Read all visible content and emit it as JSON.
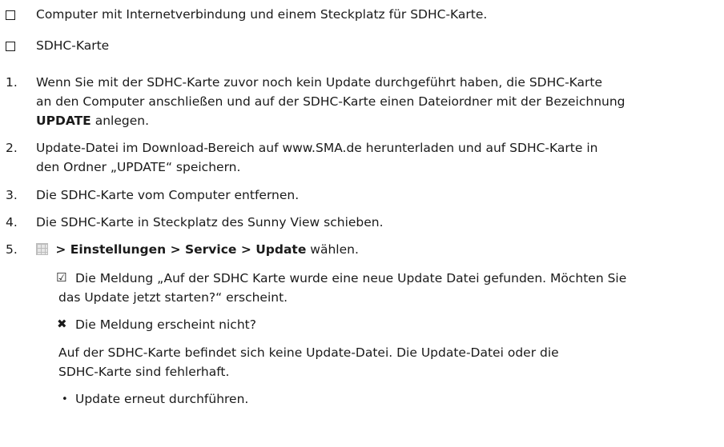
{
  "requirements": [
    "Computer mit Internetverbindung und einem Steckplatz für SDHC-Karte.",
    "SDHC-Karte"
  ],
  "steps": {
    "s1": {
      "num": "1.",
      "l1": "Wenn Sie mit der SDHC-Karte zuvor noch kein Update durchgeführt haben, die SDHC-Karte",
      "l2": "an den Computer anschließen und auf der SDHC-Karte einen Dateiordner mit der Bezeichnung",
      "l3_bold": "UPDATE",
      "l3_rest": " anlegen."
    },
    "s2": {
      "num": "2.",
      "l1": "Update-Datei im Download-Bereich auf www.SMA.de herunterladen und auf SDHC-Karte in",
      "l2": "den Ordner „UPDATE“ speichern."
    },
    "s3": {
      "num": "3.",
      "text": "Die SDHC-Karte vom Computer entfernen."
    },
    "s4": {
      "num": "4.",
      "text": "Die SDHC-Karte in Steckplatz des Sunny View schieben."
    },
    "s5": {
      "num": "5.",
      "path_bold": " > Einstellungen > Service > Update",
      "rest": " wählen."
    }
  },
  "result": {
    "l1": "Die Meldung „Auf der SDHC Karte wurde eine neue Update Datei gefunden. Möchten Sie",
    "l2": "das Update jetzt starten?“ erscheint."
  },
  "error": {
    "title": "Die Meldung erscheint nicht?",
    "l1": "Auf der SDHC-Karte befindet sich keine Update-Datei. Die Update-Datei oder die",
    "l2": "SDHC-Karte sind fehlerhaft.",
    "bullet": "Update erneut durchführen."
  },
  "icons": {
    "checkbox": "empty-checkbox-icon",
    "menu": "menu-grid-icon",
    "result": "checked-box-icon",
    "error": "cross-icon"
  }
}
